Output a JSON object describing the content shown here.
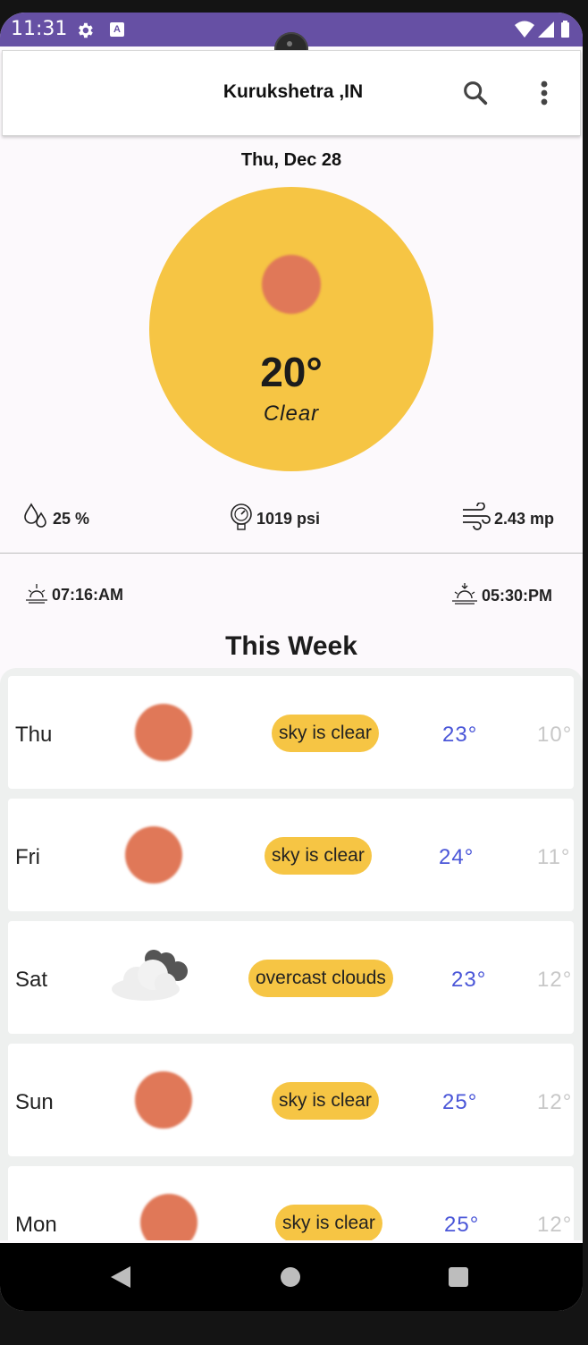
{
  "status_bar": {
    "time": "11:31"
  },
  "app_bar": {
    "title": "Kurukshetra ,IN",
    "search_icon": "search-icon",
    "menu_icon": "more-vert-icon"
  },
  "today": {
    "date": "Thu, Dec 28",
    "temperature": "20°",
    "condition": "Clear",
    "humidity": "25 %",
    "pressure": "1019 psi",
    "wind": "2.43 mp",
    "sunrise": "07:16:AM",
    "sunset": "05:30:PM"
  },
  "week": {
    "title": "This Week",
    "days": [
      {
        "day": "Thu",
        "icon": "sun-icon",
        "description": "sky is clear",
        "high": "23°",
        "low": "10°"
      },
      {
        "day": "Fri",
        "icon": "sun-icon",
        "description": "sky is clear",
        "high": "24°",
        "low": "11°"
      },
      {
        "day": "Sat",
        "icon": "cloud-icon",
        "description": "overcast clouds",
        "high": "23°",
        "low": "12°"
      },
      {
        "day": "Sun",
        "icon": "sun-icon",
        "description": "sky is clear",
        "high": "25°",
        "low": "12°"
      },
      {
        "day": "Mon",
        "icon": "sun-icon",
        "description": "sky is clear",
        "high": "25°",
        "low": "12°"
      }
    ]
  },
  "colors": {
    "accent": "#f6c544",
    "status_bar": "#6650a4",
    "sun": "#e07858",
    "high_temp": "#4a56d8",
    "low_temp": "#c8c8c8"
  }
}
